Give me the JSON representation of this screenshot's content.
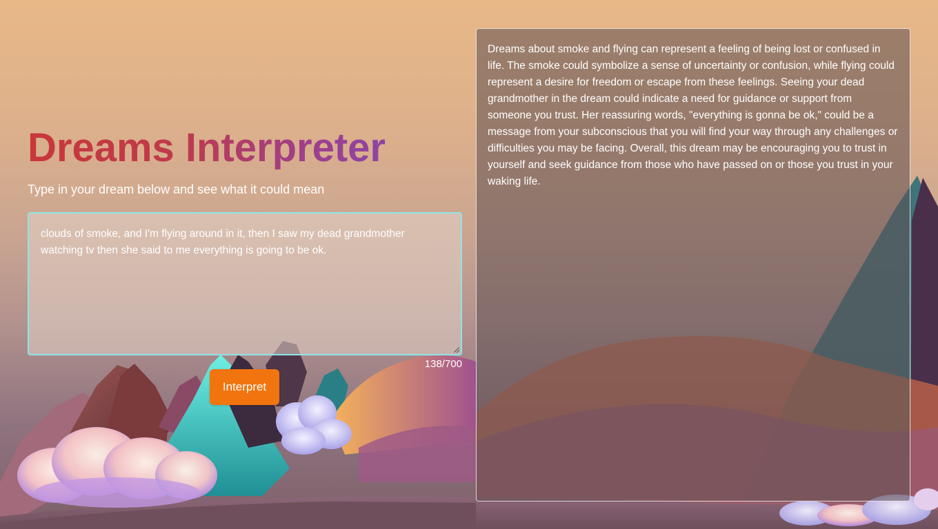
{
  "header": {
    "title": "Dreams Interpreter",
    "subtitle": "Type in your dream below and see what it could mean"
  },
  "dream_input": {
    "value": "clouds of smoke, and I'm flying around in it, then I saw my dead grandmother watching tv then she said to me everything is going to be ok.",
    "char_count": "138/700"
  },
  "actions": {
    "interpret_label": "Interpret"
  },
  "result": {
    "text": "Dreams about smoke and flying can represent a feeling of being lost or confused in life. The smoke could symbolize a sense of uncertainty or confusion, while flying could represent a desire for freedom or escape from these feelings. Seeing your dead grandmother in the dream could indicate a need for guidance or support from someone you trust. Her reassuring words, \"everything is gonna be ok,\" could be a message from your subconscious that you will find your way through any challenges or difficulties you may be facing. Overall, this dream may be encouraging you to trust in yourself and seek guidance from those who have passed on or those you trust in your waking life."
  },
  "colors": {
    "button": "#f2740f",
    "title_start": "#c8373a",
    "title_end": "#8c45a3",
    "input_border": "#8fe3ea"
  }
}
